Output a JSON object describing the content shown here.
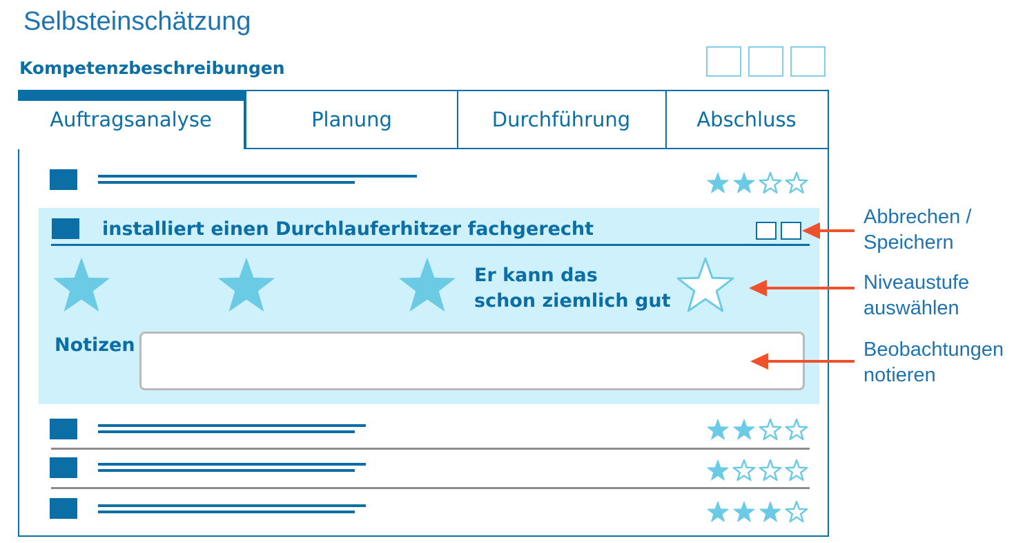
{
  "page_title": "Selbsteinschätzung",
  "section_title": "Kompetenzbeschreibungen",
  "tabs": [
    {
      "label": "Auftragsanalyse",
      "active": true
    },
    {
      "label": "Planung",
      "active": false
    },
    {
      "label": "Durchführung",
      "active": false
    },
    {
      "label": "Abschluss",
      "active": false
    }
  ],
  "rows": [
    {
      "rating": 2,
      "max": 4
    },
    {
      "rating": 2,
      "max": 4
    },
    {
      "rating": 1,
      "max": 4
    },
    {
      "rating": 3,
      "max": 4
    }
  ],
  "expanded_item": {
    "title": "installiert einen Durchlauferhitzer fachgerecht",
    "rating": 3,
    "max": 4,
    "level_text_line1": "Er kann das",
    "level_text_line2": "schon ziemlich gut",
    "notes_label": "Notizen",
    "notes_value": ""
  },
  "annotations": {
    "cancel_save_line1": "Abbrechen /",
    "cancel_save_line2": "Speichern",
    "level_line1": "Niveaustufe",
    "level_line2": "auswählen",
    "notes_line1": "Beobachtungen",
    "notes_line2": "notieren"
  },
  "colors": {
    "primary": "#0b6ea5",
    "star_fill": "#6ccbe4",
    "panel_bg": "#cff1fb",
    "arrow": "#f0512d"
  },
  "icons": {
    "star": "star-icon",
    "arrow": "arrow-left-icon"
  }
}
